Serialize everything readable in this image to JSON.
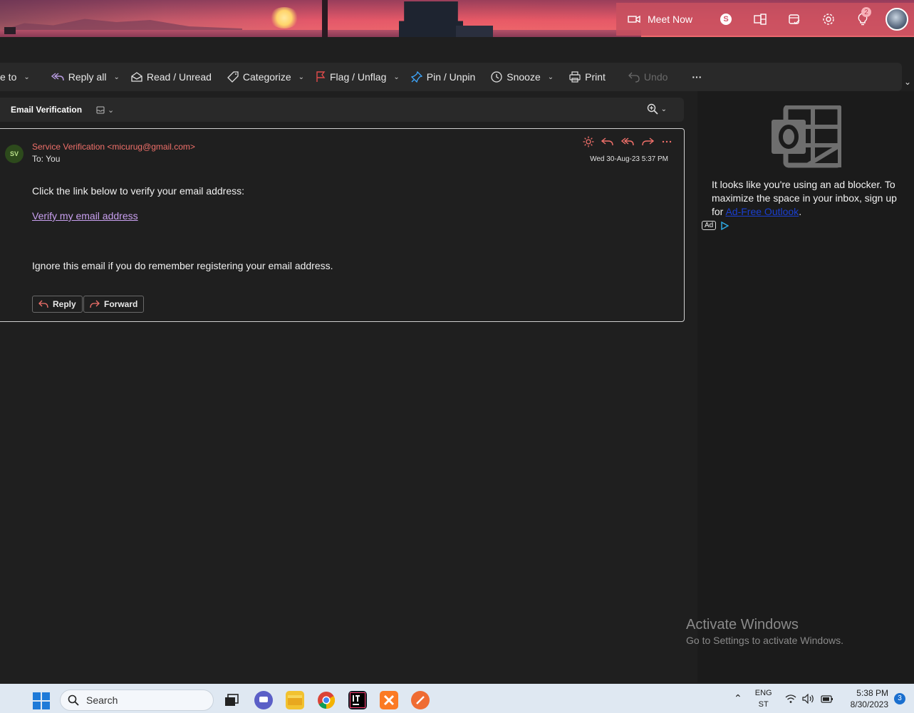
{
  "topbar": {
    "meet_label": "Meet Now",
    "notification_count": "2"
  },
  "toolbar": {
    "move_to": "e to",
    "reply_all": "Reply all",
    "read_unread": "Read / Unread",
    "categorize": "Categorize",
    "flag": "Flag / Unflag",
    "pin": "Pin / Unpin",
    "snooze": "Snooze",
    "print": "Print",
    "undo": "Undo",
    "more": "···"
  },
  "subject_bar": {
    "subject": "Email Verification"
  },
  "message": {
    "avatar_initials": "SV",
    "sender": "Service Verification <micurug@gmail.com>",
    "to": "To: You",
    "date": "Wed 30-Aug-23 5:37 PM",
    "line1": "Click the link below to verify your email address:",
    "link": "Verify my email address",
    "line2": "Ignore this email if you do remember registering your email address.",
    "reply_button": "Reply",
    "forward_button": "Forward"
  },
  "ad": {
    "text_before": "It looks like you're using an ad blocker. To maximize the space in your inbox, sign up for ",
    "link_text": "Ad-Free Outlook",
    "text_after": ".",
    "badge": "Ad"
  },
  "watermark": {
    "title": "Activate Windows",
    "subtitle": "Go to Settings to activate Windows."
  },
  "taskbar": {
    "search_placeholder": "Search",
    "lang_top": "ENG",
    "lang_bottom": "ST",
    "time": "5:38 PM",
    "date": "8/30/2023",
    "notification_count": "3"
  },
  "colors": {
    "accent": "#f0706a",
    "link": "#c9a0f0",
    "background": "#1f1f1f",
    "toolbar": "#292929"
  }
}
